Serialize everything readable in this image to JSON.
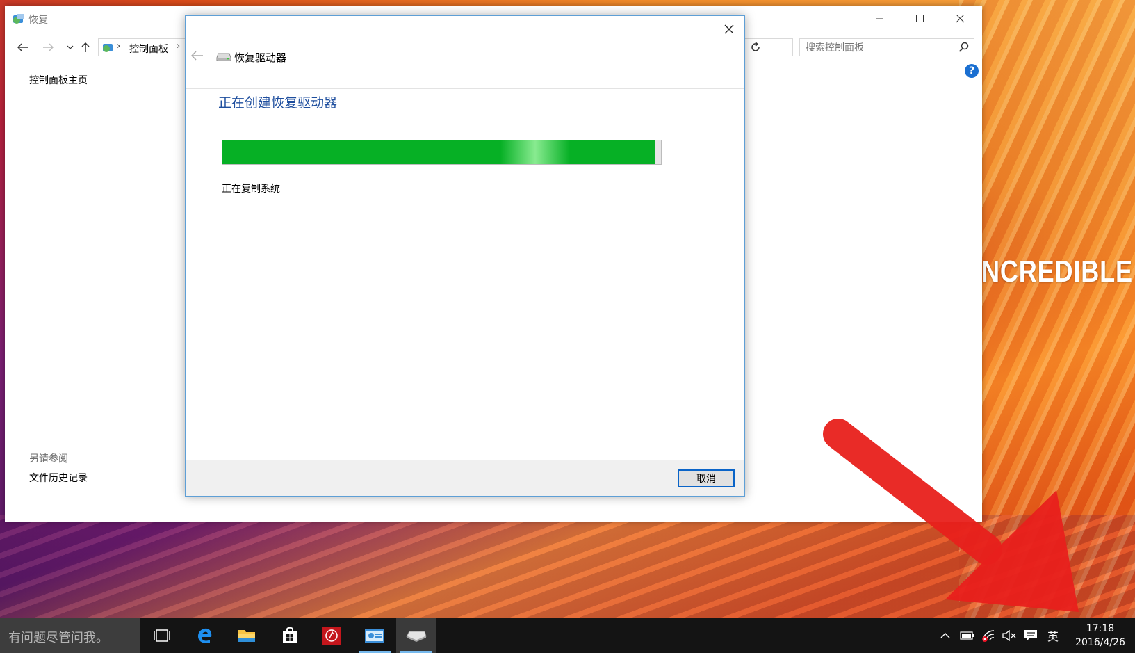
{
  "desktop": {
    "wallpaper_text": "NCREDIBLE"
  },
  "main_window": {
    "title": "恢复",
    "breadcrumb": [
      "控制面板"
    ],
    "search_placeholder": "搜索控制面板",
    "help_label": "?",
    "left_nav": {
      "home": "控制面板主页",
      "see_also_label": "另请参阅",
      "file_history": "文件历史记录"
    }
  },
  "dialog": {
    "title": "恢复驱动器",
    "heading": "正在创建恢复驱动器",
    "progress": 0.987,
    "status": "正在复制系统",
    "cancel_label": "取消"
  },
  "taskbar": {
    "search_placeholder": "有问题尽管问我。",
    "apps": [
      "task-view",
      "edge",
      "file-explorer",
      "store",
      "app-red",
      "control-panel",
      "recovery-drive"
    ],
    "ime_label": "英",
    "time": "17:18",
    "date": "2016/4/26"
  },
  "colors": {
    "accent": "#1e4e9e",
    "progress": "#06b025",
    "arrow": "#e8201c",
    "taskbar": "#141414"
  }
}
